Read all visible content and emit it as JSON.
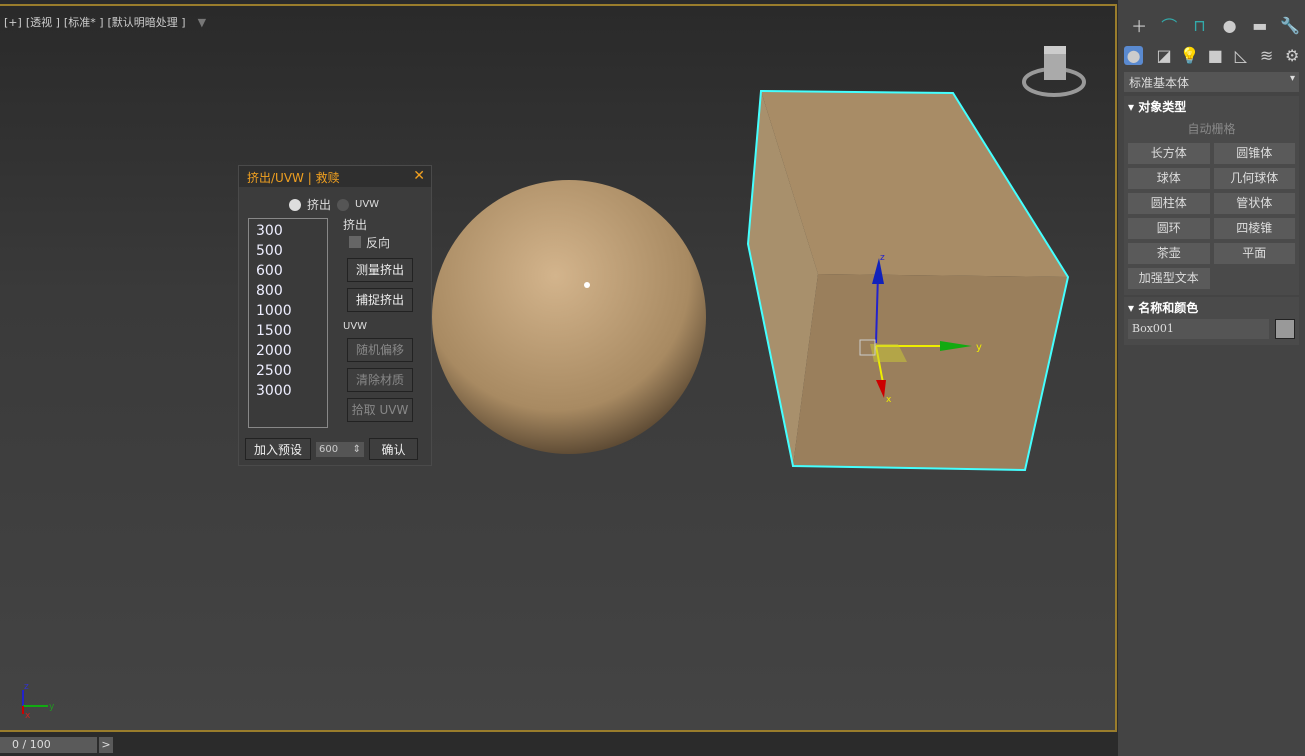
{
  "viewport": {
    "labels": [
      "[+]",
      "[透视 ]",
      "[标准* ]",
      "[默认明暗处理 ]"
    ],
    "axes": {
      "z": "z",
      "y": "y",
      "x": "x"
    }
  },
  "dialog": {
    "title": "挤出/UVW | 救赎",
    "close": "✕",
    "radio_extrude": "挤出",
    "radio_uvw": "UVW",
    "presets": [
      "300",
      "500",
      "600",
      "800",
      "1000",
      "1500",
      "2000",
      "2500",
      "3000"
    ],
    "extrude_label": "挤出",
    "reverse_label": "反向",
    "measure_btn": "测量挤出",
    "capture_btn": "捕捉挤出",
    "uvw_label": "UVW",
    "random_btn": "随机偏移",
    "clear_btn": "清除材质",
    "pick_btn": "拾取 UVW",
    "add_preset_btn": "加入预设",
    "spinner_value": "600",
    "confirm_btn": "确认"
  },
  "panel": {
    "category": "标准基本体",
    "object_type": "对象类型",
    "autogrid": "自动栅格",
    "buttons": [
      "长方体",
      "圆锥体",
      "球体",
      "几何球体",
      "圆柱体",
      "管状体",
      "圆环",
      "四棱锥",
      "茶壶",
      "平面",
      "加强型文本"
    ],
    "name_color": "名称和颜色",
    "object_name": "Box001",
    "object_color": "#999999"
  },
  "timeline": {
    "frame": "0 / 100",
    "next": ">"
  }
}
